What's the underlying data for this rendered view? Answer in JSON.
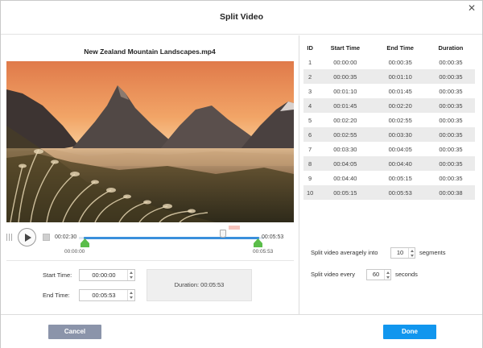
{
  "window": {
    "title": "Split Video"
  },
  "file": {
    "name": "New Zealand Mountain Landscapes.mp4"
  },
  "player": {
    "current_time": "00:02:30",
    "end_time": "00:05:53",
    "range_start": "00:00:00",
    "range_end": "00:05:53",
    "playhead_position": 0.78
  },
  "trim": {
    "start_label": "Start Time:",
    "start_value": "00:00:00",
    "end_label": "End Time:",
    "end_value": "00:05:53",
    "duration_text": "Duration:  00:05:53"
  },
  "table": {
    "headers": [
      "ID",
      "Start Time",
      "End Time",
      "Duration"
    ],
    "rows": [
      [
        "1",
        "00:00:00",
        "00:00:35",
        "00:00:35"
      ],
      [
        "2",
        "00:00:35",
        "00:01:10",
        "00:00:35"
      ],
      [
        "3",
        "00:01:10",
        "00:01:45",
        "00:00:35"
      ],
      [
        "4",
        "00:01:45",
        "00:02:20",
        "00:00:35"
      ],
      [
        "5",
        "00:02:20",
        "00:02:55",
        "00:00:35"
      ],
      [
        "6",
        "00:02:55",
        "00:03:30",
        "00:00:35"
      ],
      [
        "7",
        "00:03:30",
        "00:04:05",
        "00:00:35"
      ],
      [
        "8",
        "00:04:05",
        "00:04:40",
        "00:00:35"
      ],
      [
        "9",
        "00:04:40",
        "00:05:15",
        "00:00:35"
      ],
      [
        "10",
        "00:05:15",
        "00:05:53",
        "00:00:38"
      ]
    ]
  },
  "split": {
    "avg_label": "Split video averagely into",
    "avg_value": "10",
    "avg_unit": "segments",
    "every_label": "Split video every",
    "every_value": "60",
    "every_unit": "seconds"
  },
  "buttons": {
    "cancel": "Cancel",
    "done": "Done"
  },
  "colors": {
    "accent": "#1196ee",
    "range": "#3a8fdc",
    "handle": "#5bbd4a",
    "cancel": "#8b94aa"
  }
}
